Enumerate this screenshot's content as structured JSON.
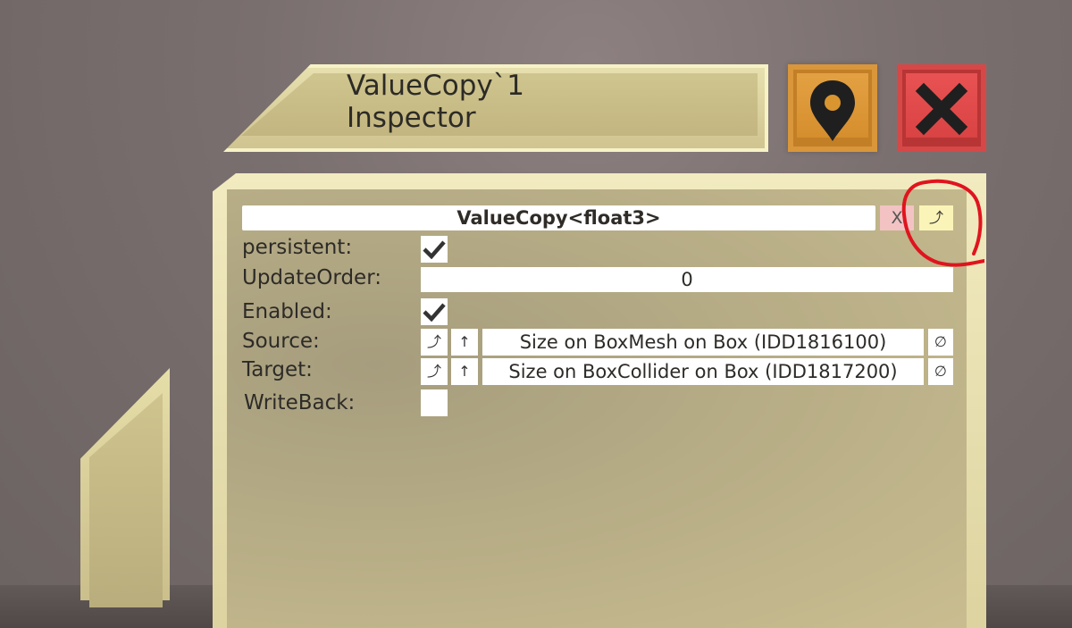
{
  "header": {
    "title_line1": "ValueCopy`1",
    "title_line2": "Inspector",
    "locate_icon": "map-pin-icon",
    "close_icon": "close-x-icon"
  },
  "component": {
    "name": "ValueCopy<float3>",
    "remove_label": "X",
    "jump_label": "⤴"
  },
  "fields": {
    "persistent": {
      "label": "persistent:",
      "checked": true
    },
    "update_order": {
      "label": "UpdateOrder:",
      "value": "0"
    },
    "enabled": {
      "label": "Enabled:",
      "checked": true
    },
    "source": {
      "label": "Source:",
      "jump": "⤴",
      "up": "↑",
      "value": "Size on BoxMesh on Box (IDD1816100)",
      "clear": "∅"
    },
    "target": {
      "label": "Target:",
      "jump": "⤴",
      "up": "↑",
      "value": "Size on BoxCollider on Box (IDD1817200)",
      "clear": "∅"
    },
    "write_back": {
      "label": "WriteBack:",
      "checked": false
    }
  },
  "colors": {
    "panel": "#ddd3a0",
    "locate_button": "#e3a143",
    "close_button": "#e85252",
    "annotation": "#e0141e"
  }
}
